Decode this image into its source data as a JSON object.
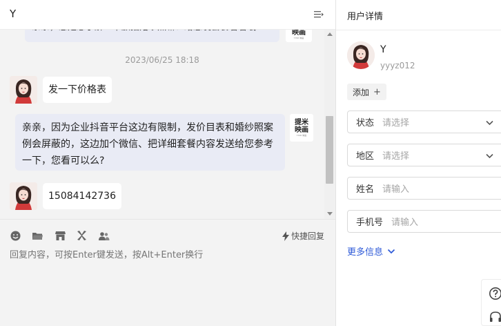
{
  "chat": {
    "title": "Y",
    "partial_message": "亲亲，您是想了解一下旅拍婚纱照嘛？给您发套餐看看哦",
    "timestamp": "2023/06/25 18:18",
    "messages": [
      {
        "side": "customer",
        "text": "发一下价格表"
      },
      {
        "side": "agent",
        "lines": [
          "亲亲，因为企业抖音平台这边有限制，发价目表和婚纱照案",
          "例会屏蔽的，这边加个微信、把详细套餐内容发送给您参考",
          "一下，您看可以么?"
        ]
      },
      {
        "side": "customer",
        "text": "15084142736"
      }
    ],
    "brand_logo": {
      "line1": "提米",
      "line2": "映画",
      "line3": "TIMI 映画"
    }
  },
  "composer": {
    "tools": [
      "emoji-icon",
      "folder-icon",
      "store-icon",
      "product-icon",
      "contacts-icon"
    ],
    "quick_reply_label": "快捷回复",
    "placeholder": "回复内容，可按Enter键发送，按Alt+Enter换行"
  },
  "detail": {
    "title": "用户详情",
    "user": {
      "name": "Y",
      "id": "yyyz012"
    },
    "add_tag_label": "添加",
    "fields": [
      {
        "label": "状态",
        "value": "请选择",
        "type": "select"
      },
      {
        "label": "地区",
        "value": "请选择",
        "type": "select"
      },
      {
        "label": "姓名",
        "value": "请输入",
        "type": "input"
      },
      {
        "label": "手机号",
        "value": "请输入",
        "type": "input"
      }
    ],
    "more_info_label": "更多信息"
  },
  "colors": {
    "accent": "#2f5bd8",
    "agent_bubble": "#e9ebf5",
    "chat_bg": "#f3f3f3"
  }
}
